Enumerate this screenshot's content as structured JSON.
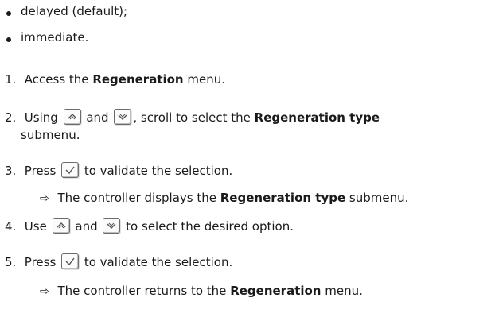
{
  "options": [
    "delayed (default);",
    "immediate."
  ],
  "steps": {
    "s1": {
      "num": "1.",
      "pre": "Access the",
      "bold": "Regeneration",
      "post": "menu."
    },
    "s2": {
      "num": "2.",
      "pre": "Using",
      "and": "and",
      "mid": ", scroll to select the",
      "bold": "Regeneration type",
      "cont": "submenu."
    },
    "s3": {
      "num": "3.",
      "pre": "Press",
      "post": "to validate the selection."
    },
    "r3": {
      "arrow": "⇨",
      "pre": "The controller displays the",
      "bold": "Regeneration type",
      "post": "submenu."
    },
    "s4": {
      "num": "4.",
      "pre": "Use",
      "and": "and",
      "post": "to select the desired option."
    },
    "s5": {
      "num": "5.",
      "pre": "Press",
      "post": "to validate the selection."
    },
    "r5": {
      "arrow": "⇨",
      "pre": "The controller returns to the",
      "bold": "Regeneration",
      "post": "menu."
    }
  },
  "icons": {
    "up": "up-chevron-key-icon",
    "down": "down-chevron-key-icon",
    "check": "checkmark-key-icon"
  }
}
